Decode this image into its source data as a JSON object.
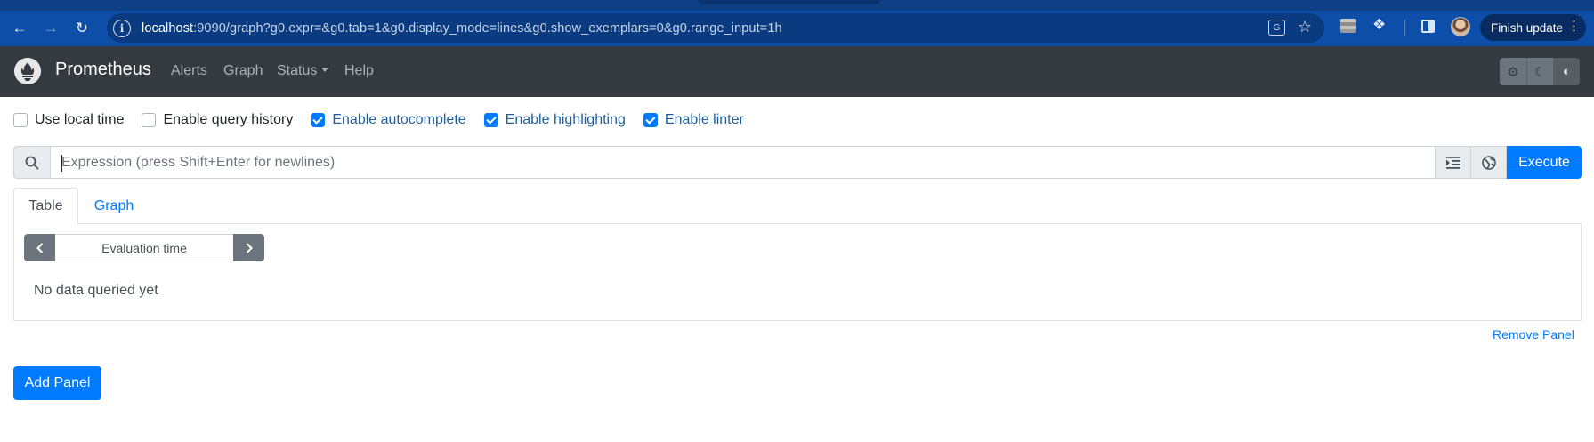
{
  "browser": {
    "url_host": "localhost",
    "url_rest": ":9090/graph?g0.expr=&g0.tab=1&g0.display_mode=lines&g0.show_exemplars=0&g0.range_input=1h",
    "finish_update_label": "Finish update",
    "icons": [
      "back-icon",
      "forward-icon",
      "reload-icon",
      "site-info-icon",
      "translate-icon",
      "star-icon",
      "extension-icon",
      "puzzle-icon",
      "side-panel-icon",
      "avatar",
      "more-icon"
    ]
  },
  "navbar": {
    "brand": "Prometheus",
    "links": [
      "Alerts",
      "Graph",
      "Status",
      "Help"
    ],
    "theme_buttons": [
      "sun-icon",
      "moon-icon",
      "contrast-icon"
    ],
    "colors": {
      "bg": "#343a40"
    }
  },
  "options": [
    {
      "label": "Use local time",
      "checked": false
    },
    {
      "label": "Enable query history",
      "checked": false
    },
    {
      "label": "Enable autocomplete",
      "checked": true
    },
    {
      "label": "Enable highlighting",
      "checked": true
    },
    {
      "label": "Enable linter",
      "checked": true
    }
  ],
  "expression": {
    "placeholder": "Expression (press Shift+Enter for newlines)",
    "value": "",
    "execute_label": "Execute"
  },
  "panel": {
    "tabs": [
      {
        "label": "Table",
        "active": true
      },
      {
        "label": "Graph",
        "active": false
      }
    ],
    "evaluation_time_placeholder": "Evaluation time",
    "empty_message": "No data queried yet",
    "remove_label": "Remove Panel"
  },
  "add_panel_label": "Add Panel",
  "colors": {
    "primary": "#007bff",
    "secondary": "#6c757d"
  }
}
